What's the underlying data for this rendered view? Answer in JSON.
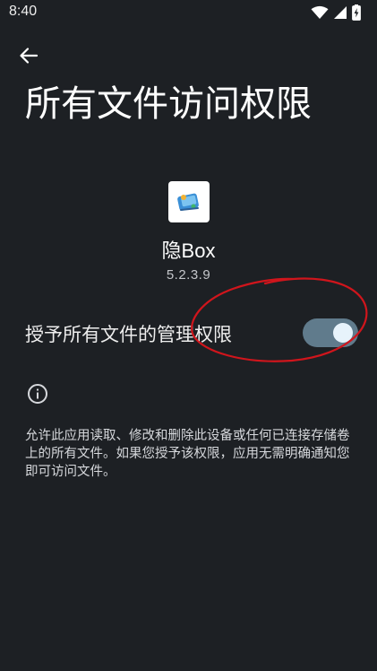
{
  "status_bar": {
    "time": "8:40",
    "icons": [
      "wifi-icon",
      "cellular-signal-icon",
      "battery-charging-icon"
    ]
  },
  "app_bar": {
    "back_icon": "arrow-back-icon",
    "title": "所有文件访问权限"
  },
  "app_header": {
    "icon": "app-logo-icon",
    "name": "隐Box",
    "version": "5.2.3.9"
  },
  "permission": {
    "label": "授予所有文件的管理权限",
    "enabled": true
  },
  "info": {
    "icon": "info-icon",
    "description": "允许此应用读取、修改和删除此设备或任何已连接存储卷上的所有文件。如果您授予该权限，应用无需明确通知您即可访问文件。"
  },
  "colors": {
    "background": "#1d2024",
    "switch_track": "#607b8c",
    "switch_thumb": "#e7f3fb",
    "annotation": "#d0151c"
  }
}
